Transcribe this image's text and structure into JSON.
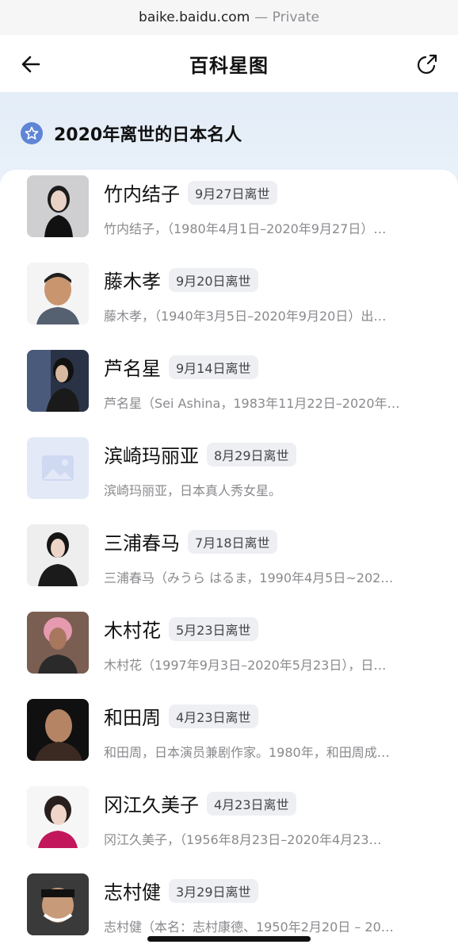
{
  "browser": {
    "domain": "baike.baidu.com",
    "mode": "— Private"
  },
  "header": {
    "title": "百科星图",
    "back_icon": "arrow-left-icon",
    "share_icon": "share-icon"
  },
  "section": {
    "title": "2020年离世的日本名人",
    "icon": "star-badge-icon",
    "accent": "#5f85d6"
  },
  "people": [
    {
      "name": "竹内结子",
      "date": "9月27日离世",
      "desc": "竹内结子，（1980年4月1日–2020年9月27日）…"
    },
    {
      "name": "藤木孝",
      "date": "9月20日离世",
      "desc": "藤木孝，（1940年3月5日–2020年9月20日）出…"
    },
    {
      "name": "芦名星",
      "date": "9月14日离世",
      "desc": "芦名星（Sei Ashina，1983年11月22日–2020年…"
    },
    {
      "name": "滨崎玛丽亚",
      "date": "8月29日离世",
      "desc": "滨崎玛丽亚，日本真人秀女星。"
    },
    {
      "name": "三浦春马",
      "date": "7月18日离世",
      "desc": "三浦春马（みうら はるま，1990年4月5日~202…"
    },
    {
      "name": "木村花",
      "date": "5月23日离世",
      "desc": "木村花（1997年9月3日–2020年5月23日），日…"
    },
    {
      "name": "和田周",
      "date": "4月23日离世",
      "desc": "和田周，日本演员兼剧作家。1980年，和田周成…"
    },
    {
      "name": "冈江久美子",
      "date": "4月23日离世",
      "desc": "冈江久美子，（1956年8月23日–2020年4月23…"
    },
    {
      "name": "志村健",
      "date": "3月29日离世",
      "desc": "志村健（本名：志村康德、1950年2月20日 – 20…"
    }
  ]
}
